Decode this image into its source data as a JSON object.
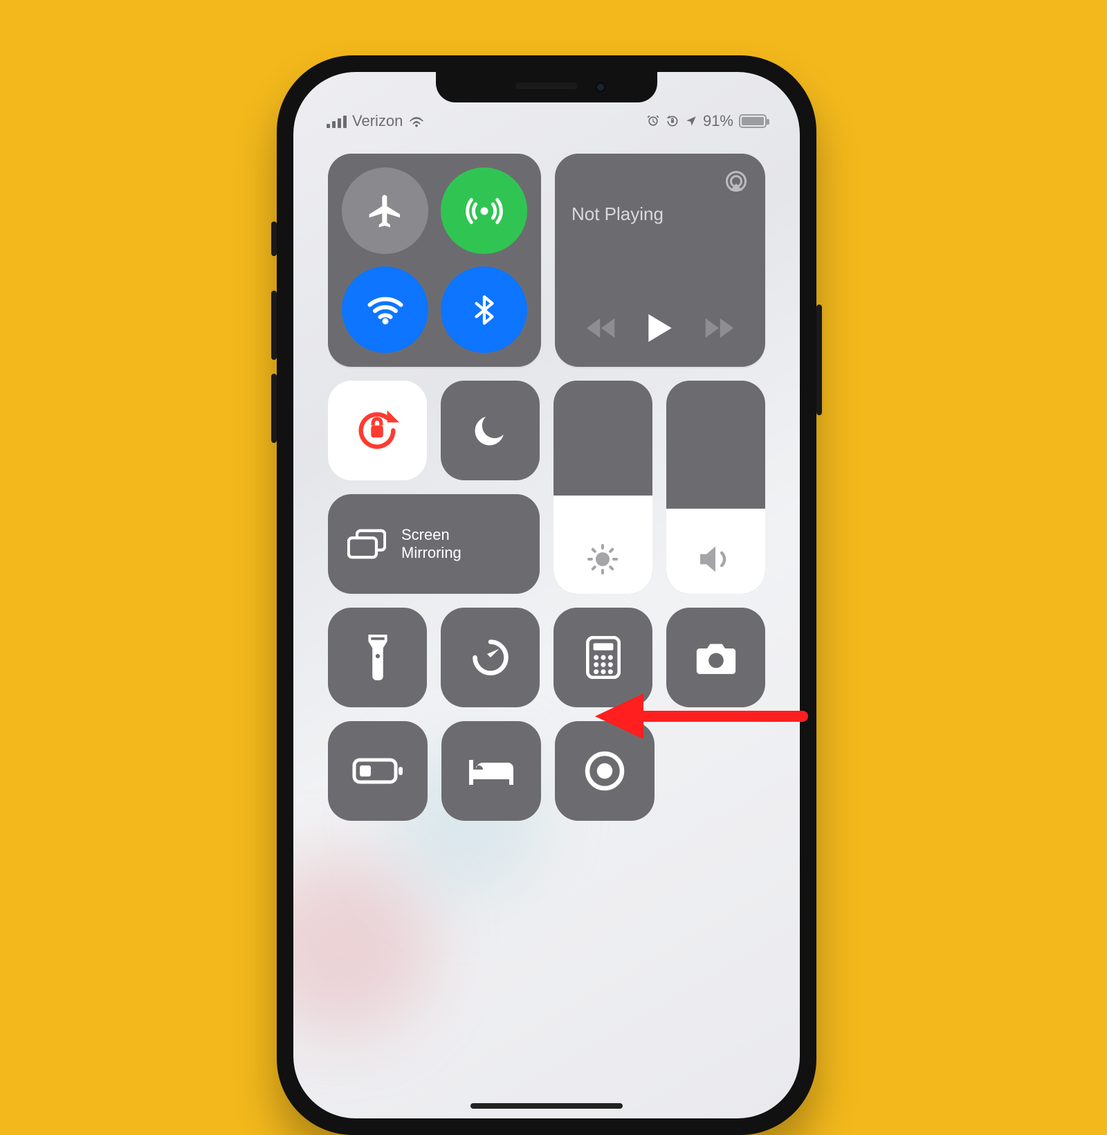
{
  "status_bar": {
    "carrier": "Verizon",
    "battery_percent": "91%"
  },
  "media": {
    "title": "Not Playing"
  },
  "screen_mirroring": {
    "line1": "Screen",
    "line2": "Mirroring"
  },
  "sliders": {
    "brightness_percent": 46,
    "volume_percent": 40
  }
}
